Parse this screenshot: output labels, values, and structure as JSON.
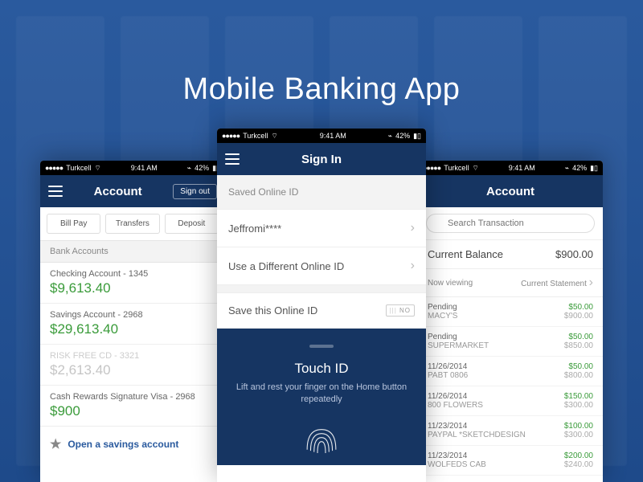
{
  "hero": {
    "title": "Mobile Banking App"
  },
  "status": {
    "carrier": "Turkcell",
    "time": "9:41 AM",
    "battery": "42%"
  },
  "left": {
    "nav_title": "Account",
    "signout": "Sign out",
    "tabs": {
      "billpay": "Bill Pay",
      "transfers": "Transfers",
      "deposit": "Deposit"
    },
    "section": "Bank Accounts",
    "accounts": [
      {
        "name": "Checking Account - 1345",
        "bal": "$9,613.40"
      },
      {
        "name": "Savings Account - 2968",
        "bal": "$29,613.40"
      },
      {
        "name": "RISK FREE CD - 3321",
        "bal": "$2,613.40"
      },
      {
        "name": "Cash Rewards Signature Visa - 2968",
        "bal": "$900"
      }
    ],
    "promo": "Open a savings account"
  },
  "center": {
    "nav_title": "Sign In",
    "saved_hdr": "Saved Online ID",
    "user": "Jeffromi****",
    "different": "Use a Different Online ID",
    "save_this": "Save this Online ID",
    "toggle": "NO",
    "touchid_title": "Touch ID",
    "touchid_sub": "Lift and rest your finger on the Home button repeatedly"
  },
  "right": {
    "nav_title": "Account",
    "search_ph": "Search Transaction",
    "balance_label": "Current Balance",
    "balance_val": "$900.00",
    "viewing_label": "Now viewing",
    "viewing_val": "Current Statement",
    "txns": [
      {
        "date": "Pending",
        "merchant": "MACY'S",
        "amt": "$50.00",
        "bal": "$900.00"
      },
      {
        "date": "Pending",
        "merchant": "SUPERMARKET",
        "amt": "$50.00",
        "bal": "$850.00"
      },
      {
        "date": "11/26/2014",
        "merchant": "PABT 0806",
        "amt": "$50.00",
        "bal": "$800.00"
      },
      {
        "date": "11/26/2014",
        "merchant": "800 FLOWERS",
        "amt": "$150.00",
        "bal": "$300.00"
      },
      {
        "date": "11/23/2014",
        "merchant": "PAYPAL *SKETCHDESIGN",
        "amt": "$100.00",
        "bal": "$300.00"
      },
      {
        "date": "11/23/2014",
        "merchant": "WOLFEDS CAB",
        "amt": "$200.00",
        "bal": "$240.00"
      }
    ]
  }
}
